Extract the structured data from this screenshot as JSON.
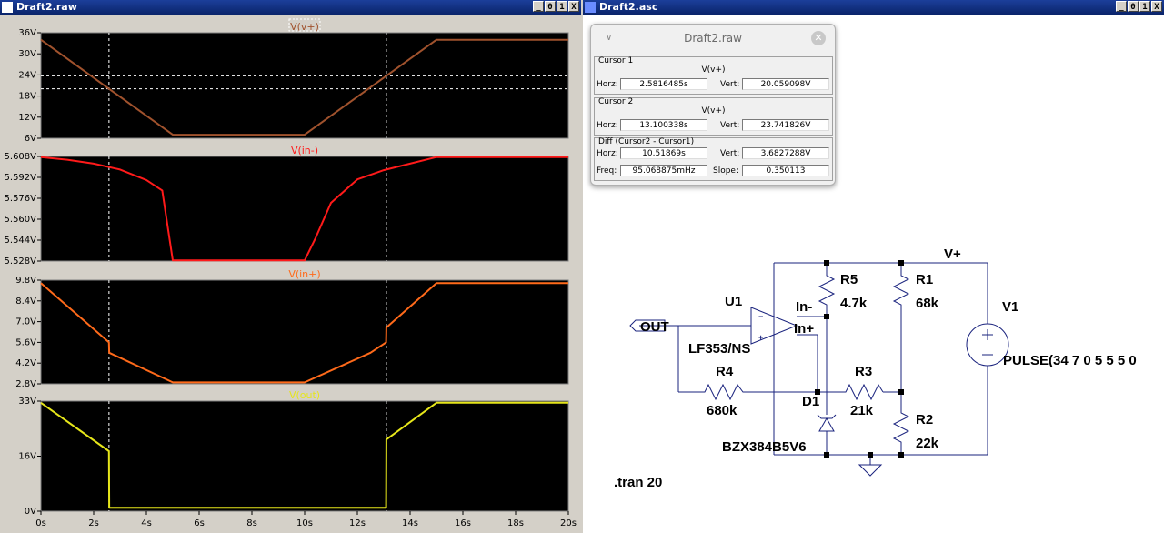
{
  "plot_window": {
    "title": "Draft2.raw",
    "buttons": [
      "_",
      "0",
      "1",
      "X"
    ],
    "panes": [
      {
        "trace": "V(v+)",
        "color": "#a0522d",
        "y_ticks": [
          "36V",
          "30V",
          "24V",
          "18V",
          "12V",
          "6V"
        ]
      },
      {
        "trace": "V(in-)",
        "color": "#ff1a1a",
        "y_ticks": [
          "5.608V",
          "5.592V",
          "5.576V",
          "5.560V",
          "5.544V",
          "5.528V"
        ]
      },
      {
        "trace": "V(in+)",
        "color": "#ff6a1a",
        "y_ticks": [
          "9.8V",
          "8.4V",
          "7.0V",
          "5.6V",
          "4.2V",
          "2.8V"
        ]
      },
      {
        "trace": "V(out)",
        "color": "#e6e61a",
        "y_ticks": [
          "33V",
          "16V",
          "0V"
        ]
      }
    ],
    "x_ticks": [
      "0s",
      "2s",
      "4s",
      "6s",
      "8s",
      "10s",
      "12s",
      "14s",
      "16s",
      "18s",
      "20s"
    ]
  },
  "chart_data": [
    {
      "type": "line",
      "title": "V(v+)",
      "x": [
        0,
        5.0,
        10.0,
        15.0,
        20.0
      ],
      "series": [
        {
          "name": "V(v+)",
          "values": [
            34,
            7,
            7,
            34,
            34
          ]
        }
      ],
      "ylim": [
        6,
        36
      ],
      "xlim": [
        0,
        20
      ],
      "grid": false
    },
    {
      "type": "line",
      "title": "V(in-)",
      "x": [
        0,
        1,
        2,
        3,
        4,
        4.6,
        5.0,
        10.0,
        10.4,
        11,
        12,
        13,
        14,
        15,
        20
      ],
      "series": [
        {
          "name": "V(in-)",
          "values": [
            5.6075,
            5.6055,
            5.6025,
            5.598,
            5.59,
            5.582,
            5.5285,
            5.5285,
            5.545,
            5.5725,
            5.5905,
            5.5975,
            5.6025,
            5.6075,
            5.6075
          ]
        }
      ],
      "ylim": [
        5.528,
        5.608
      ],
      "xlim": [
        0,
        20
      ],
      "grid": false
    },
    {
      "type": "line",
      "title": "V(in+)",
      "x": [
        0,
        2.58,
        2.59,
        5.0,
        10.0,
        12.5,
        13.09,
        13.1,
        15.0,
        20.0
      ],
      "series": [
        {
          "name": "V(in+)",
          "values": [
            9.6,
            5.6,
            4.9,
            2.9,
            2.9,
            4.9,
            5.6,
            6.6,
            9.6,
            9.6
          ]
        }
      ],
      "ylim": [
        2.8,
        9.8
      ],
      "xlim": [
        0,
        20
      ],
      "grid": false
    },
    {
      "type": "line",
      "title": "V(out)",
      "x": [
        0,
        2.58,
        2.59,
        13.09,
        13.1,
        15.0,
        20.0
      ],
      "series": [
        {
          "name": "V(out)",
          "values": [
            32.5,
            18,
            1,
            1,
            21.5,
            32.5,
            32.5
          ]
        }
      ],
      "ylim": [
        0,
        33
      ],
      "xlim": [
        0,
        20
      ],
      "grid": false
    }
  ],
  "cursors": {
    "cursor1_x": 2.5816485,
    "cursor1_y": 20.059098,
    "cursor2_x": 13.100338,
    "cursor2_y": 23.741826
  },
  "cursor_window": {
    "title": "Draft2.raw",
    "cursor1": {
      "label": "Cursor 1",
      "trace": "V(v+)",
      "horz_label": "Horz:",
      "horz": "2.5816485s",
      "vert_label": "Vert:",
      "vert": "20.059098V"
    },
    "cursor2": {
      "label": "Cursor 2",
      "trace": "V(v+)",
      "horz_label": "Horz:",
      "horz": "13.100338s",
      "vert_label": "Vert:",
      "vert": "23.741826V"
    },
    "diff": {
      "label": "Diff (Cursor2 - Cursor1)",
      "horz_label": "Horz:",
      "horz": "10.51869s",
      "vert_label": "Vert:",
      "vert": "3.6827288V",
      "freq_label": "Freq:",
      "freq": "95.068875mHz",
      "slope_label": "Slope:",
      "slope": "0.350113"
    }
  },
  "schematic_window": {
    "title": "Draft2.asc",
    "buttons": [
      "_",
      "0",
      "1",
      "X"
    ],
    "labels": {
      "vplus": "V+",
      "u1": "U1",
      "opamp_model": "LF353/NS",
      "in_minus": "In-",
      "in_plus": "In+",
      "out": "OUT",
      "r5": "R5",
      "r5_val": "4.7k",
      "r1": "R1",
      "r1_val": "68k",
      "r4": "R4",
      "r4_val": "680k",
      "r3": "R3",
      "r3_val": "21k",
      "r2": "R2",
      "r2_val": "22k",
      "d1": "D1",
      "d1_model": "BZX384B5V6",
      "v1": "V1",
      "v1_val": "PULSE(34 7 0 5 5 5 0",
      "tran": ".tran 20"
    }
  }
}
